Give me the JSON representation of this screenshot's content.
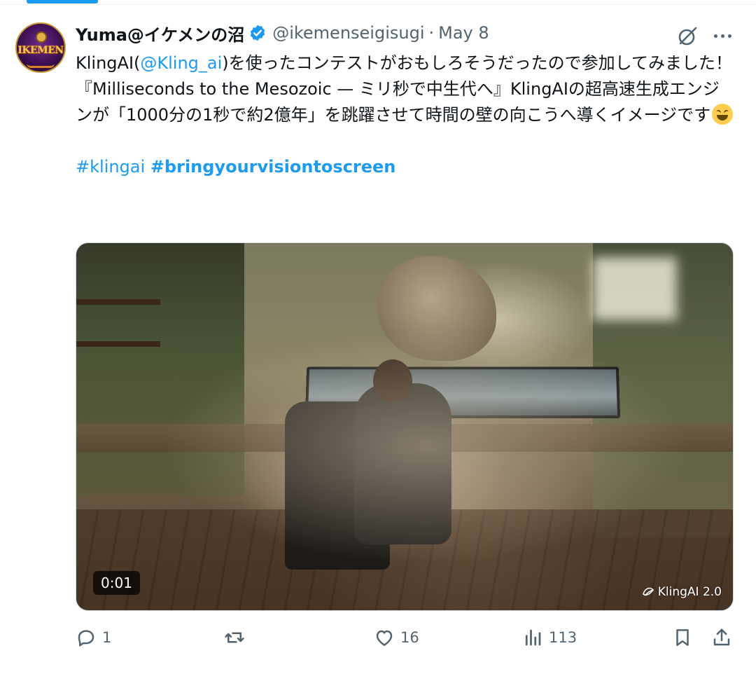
{
  "author": {
    "display_name": "Yuma@イケメンの沼",
    "handle": "@ikemenseigisugi",
    "separator": "·",
    "date": "May 8",
    "avatar_text": "IKEMEN"
  },
  "tweet": {
    "line1_pre": "KlingAI(",
    "mention": "@Kling_ai",
    "line1_post": ")を使ったコンテストがおもしろそうだったので参加してみました！",
    "line2": "『Milliseconds to the Mesozoic — ミリ秒で中生代へ』KlingAIの超高速生成エンジンが「1000分の1秒で約2億年」を跳躍させて時間の壁の向こうへ導くイメージです",
    "hashtag1": "#klingai",
    "hashtag2": "#bringyourvisiontoscreen"
  },
  "media": {
    "duration": "0:01",
    "watermark": "KlingAI 2.0"
  },
  "actions": {
    "replies": "1",
    "reposts": "",
    "likes": "16",
    "views": "113"
  },
  "colors": {
    "accent": "#1d9bf0",
    "text": "#0f1419",
    "muted": "#536471"
  },
  "icons": [
    "verified-badge-icon",
    "grok-icon",
    "more-icon",
    "reply-icon",
    "repost-icon",
    "like-icon",
    "views-icon",
    "bookmark-icon",
    "share-icon",
    "kling-logo-icon"
  ]
}
